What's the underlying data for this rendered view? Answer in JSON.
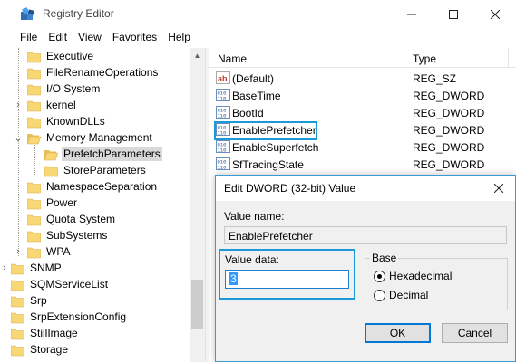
{
  "window": {
    "title": "Registry Editor"
  },
  "menu": [
    "File",
    "Edit",
    "View",
    "Favorites",
    "Help"
  ],
  "tree": {
    "items": [
      {
        "label": "Executive"
      },
      {
        "label": "FileRenameOperations"
      },
      {
        "label": "I/O System"
      },
      {
        "label": "kernel"
      },
      {
        "label": "KnownDLLs"
      },
      {
        "label": "Memory Management"
      },
      {
        "label": "PrefetchParameters"
      },
      {
        "label": "StoreParameters"
      },
      {
        "label": "NamespaceSeparation"
      },
      {
        "label": "Power"
      },
      {
        "label": "Quota System"
      },
      {
        "label": "SubSystems"
      },
      {
        "label": "WPA"
      },
      {
        "label": "SNMP"
      },
      {
        "label": "SQMServiceList"
      },
      {
        "label": "Srp"
      },
      {
        "label": "SrpExtensionConfig"
      },
      {
        "label": "StillImage"
      },
      {
        "label": "Storage"
      }
    ]
  },
  "list": {
    "columns": {
      "name": "Name",
      "type": "Type"
    },
    "rows": [
      {
        "name": "(Default)",
        "type": "REG_SZ",
        "icon": "string-value-icon"
      },
      {
        "name": "BaseTime",
        "type": "REG_DWORD",
        "icon": "binary-value-icon"
      },
      {
        "name": "BootId",
        "type": "REG_DWORD",
        "icon": "binary-value-icon"
      },
      {
        "name": "EnablePrefetcher",
        "type": "REG_DWORD",
        "icon": "binary-value-icon"
      },
      {
        "name": "EnableSuperfetch",
        "type": "REG_DWORD",
        "icon": "binary-value-icon"
      },
      {
        "name": "SfTracingState",
        "type": "REG_DWORD",
        "icon": "binary-value-icon"
      }
    ]
  },
  "dialog": {
    "title": "Edit DWORD (32-bit) Value",
    "value_name_label": "Value name:",
    "value_name": "EnablePrefetcher",
    "value_data_label": "Value data:",
    "value_data": "3",
    "base_label": "Base",
    "hex_label": "Hexadecimal",
    "dec_label": "Decimal",
    "base_selected": "Hexadecimal",
    "ok_label": "OK",
    "cancel_label": "Cancel"
  },
  "colors": {
    "highlight": "#1a9ad6",
    "folder": "#f8d775"
  }
}
